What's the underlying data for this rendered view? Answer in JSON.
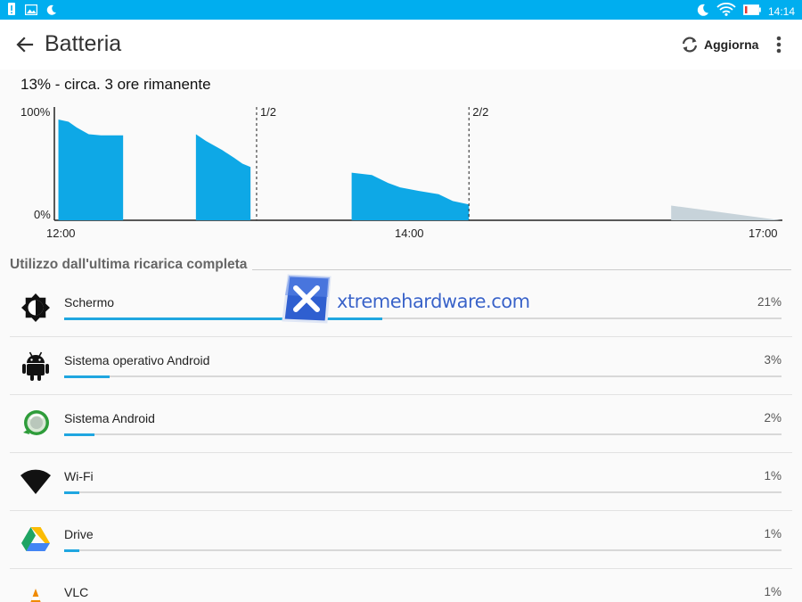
{
  "status_bar": {
    "time": "14:14",
    "background_color": "#00aeef",
    "left_icons": [
      "alert-icon",
      "image-icon",
      "moon-icon"
    ],
    "right_icons": [
      "moon-icon",
      "wifi-icon",
      "battery-low-icon"
    ]
  },
  "app_bar": {
    "title": "Batteria",
    "refresh_label": "Aggiorna",
    "back_icon": "arrow-back-icon",
    "refresh_icon": "refresh-icon",
    "more_icon": "more-vert-icon"
  },
  "summary": "13% - circa. 3 ore rimanente",
  "chart_data": {
    "type": "area",
    "color": "#0ea8e6",
    "prediction_color": "#c7d3da",
    "ytick_labels": [
      "100%",
      "0%"
    ],
    "xtick_labels": [
      "12:00",
      "14:00",
      "17:00"
    ],
    "markers": [
      {
        "label": "1/2",
        "time": "13:35"
      },
      {
        "label": "2/2",
        "time": "15:20"
      }
    ],
    "x_range": [
      "12:00",
      "17:00"
    ],
    "ylim": [
      0,
      100
    ],
    "segments": [
      {
        "x": [
          "11:57",
          "12:02",
          "12:06",
          "12:10",
          "12:12",
          "12:18",
          "12:22",
          "12:29"
        ],
        "y": [
          89,
          87,
          82,
          78,
          76,
          75,
          75,
          75
        ]
      },
      {
        "x": [
          "13:05",
          "13:10",
          "13:18",
          "13:24",
          "13:28",
          "13:32"
        ],
        "y": [
          76,
          70,
          62,
          55,
          50,
          47
        ]
      },
      {
        "x": [
          "14:22",
          "14:32",
          "14:40",
          "14:46",
          "14:55",
          "15:05",
          "15:12",
          "15:20"
        ],
        "y": [
          42,
          40,
          33,
          29,
          26,
          23,
          17,
          14
        ]
      }
    ],
    "prediction": {
      "x": [
        "17:00",
        "17:54"
      ],
      "y": [
        13,
        0
      ]
    }
  },
  "section_title": "Utilizzo dall'ultima ricarica completa",
  "usage": [
    {
      "name": "Schermo",
      "percent_text": "21%",
      "value": 21,
      "icon": "brightness-icon"
    },
    {
      "name": "Sistema operativo Android",
      "percent_text": "3%",
      "value": 3,
      "icon": "android-icon"
    },
    {
      "name": "Sistema Android",
      "percent_text": "2%",
      "value": 2,
      "icon": "android-system-icon"
    },
    {
      "name": "Wi-Fi",
      "percent_text": "1%",
      "value": 1,
      "icon": "wifi-icon"
    },
    {
      "name": "Drive",
      "percent_text": "1%",
      "value": 1,
      "icon": "drive-icon"
    },
    {
      "name": "VLC",
      "percent_text": "1%",
      "value": 1,
      "icon": "vlc-icon"
    }
  ],
  "watermark": {
    "text": "xtremehardware.com",
    "icon": "x-logo-icon"
  }
}
